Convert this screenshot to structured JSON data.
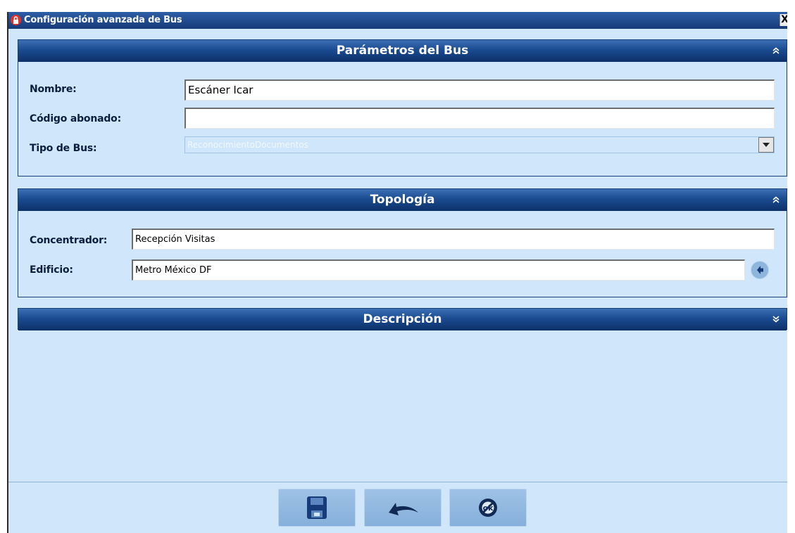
{
  "window": {
    "title": "Configuración avanzada de Bus",
    "close_label": "X"
  },
  "sections": {
    "parametros": {
      "title": "Parámetros del Bus",
      "toggle_icon": "collapse-up-icon",
      "fields": {
        "nombre": {
          "label": "Nombre:",
          "value": "Escáner Icar"
        },
        "codigo": {
          "label": "Código abonado:",
          "value": ""
        },
        "tipo": {
          "label": "Tipo de Bus:",
          "value": "ReconocimientoDocumentos"
        }
      }
    },
    "topologia": {
      "title": "Topología",
      "toggle_icon": "collapse-up-icon",
      "fields": {
        "concentrador": {
          "label": "Concentrador:",
          "value": "Recepción Visitas"
        },
        "edificio": {
          "label": "Edificio:",
          "value": "Metro México DF"
        }
      }
    },
    "descripcion": {
      "title": "Descripción",
      "toggle_icon": "expand-down-icon"
    }
  },
  "toolbar": {
    "buttons": [
      "save-icon",
      "undo-icon",
      "cancel-icon"
    ]
  },
  "colors": {
    "background": "#cfe6fb",
    "header_dark": "#0d3067",
    "header_light": "#3c6fb4",
    "button": "#8eb6dd"
  }
}
